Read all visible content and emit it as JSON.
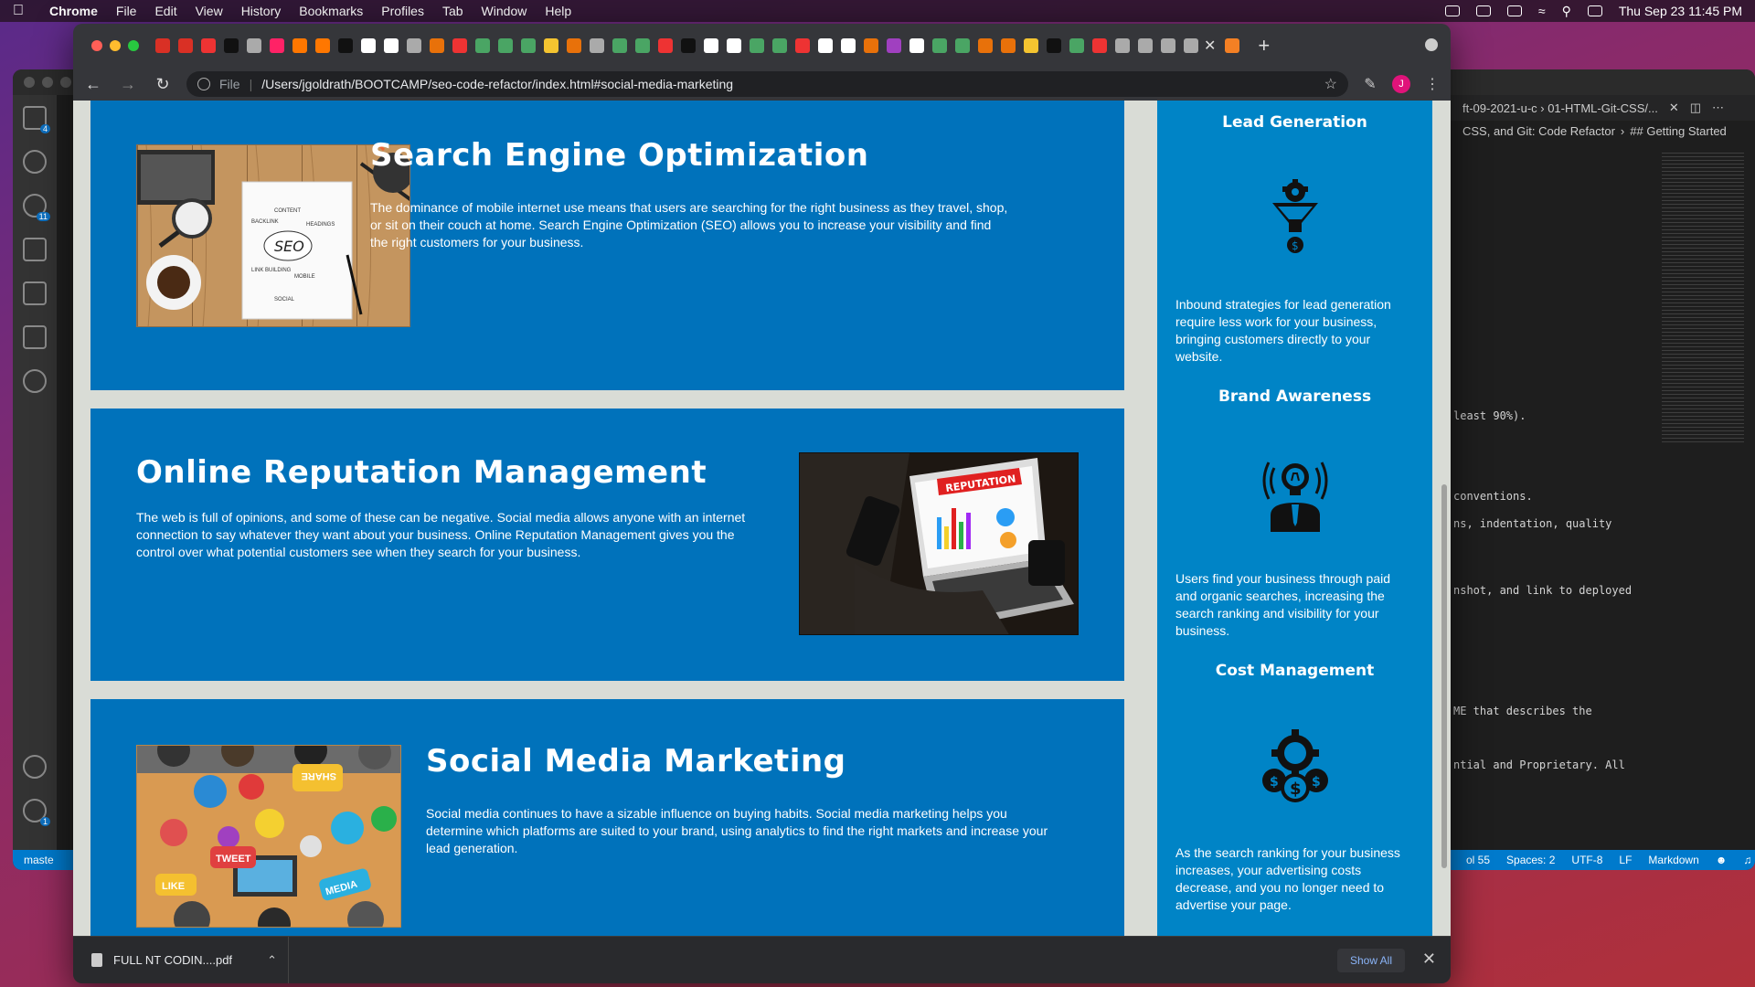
{
  "menubar": {
    "app": "Chrome",
    "items": [
      "File",
      "Edit",
      "View",
      "History",
      "Bookmarks",
      "Profiles",
      "Tab",
      "Window",
      "Help"
    ],
    "datetime": "Thu Sep 23  11:45 PM"
  },
  "browser": {
    "scheme": "File",
    "url": "/Users/jgoldrath/BOOTCAMP/seo-code-refactor/index.html#social-media-marketing",
    "avatar_initial": "J",
    "download": {
      "file": "FULL NT CODIN....pdf",
      "show_all": "Show All"
    }
  },
  "content": [
    {
      "title": "Search Engine Optimization",
      "text": "The dominance of mobile internet use means that users are searching for the right business as they travel, shop, or sit on their couch at home. Search Engine Optimization (SEO) allows you to increase your visibility and find the right customers for your business.",
      "image_icon": "seo-notebook-icon"
    },
    {
      "title": "Online Reputation Management",
      "text": "The web is full of opinions, and some of these can be negative. Social media allows anyone with an internet connection to say whatever they want about your business. Online Reputation Management gives you the control over what potential customers see when they search for your business.",
      "image_label": "REPUTATION",
      "image_icon": "laptop-reputation-icon"
    },
    {
      "title": "Social Media Marketing",
      "text": "Social media continues to have a sizable influence on buying habits. Social media marketing helps you determine which platforms are suited to your brand, using analytics to find the right markets and increase your lead generation.",
      "image_words": [
        "SHARE",
        "TWEET",
        "LIKE",
        "MEDIA"
      ],
      "image_icon": "social-media-icon"
    }
  ],
  "benefits": [
    {
      "title": "Lead Generation",
      "text": "Inbound strategies for lead generation require less work for your business, bringing customers directly to your website.",
      "icon": "funnel-dollar-icon"
    },
    {
      "title": "Brand Awareness",
      "text": "Users find your business through paid and organic searches, increasing the search ranking and visibility for your business.",
      "icon": "lightbulb-person-icon"
    },
    {
      "title": "Cost Management",
      "text": "As the search ranking for your business increases, your advertising costs decrease, and you no longer need to advertise your page.",
      "icon": "gear-dollar-icon"
    }
  ],
  "vscode": {
    "tab": "ft-09-2021-u-c › 01-HTML-Git-CSS/...",
    "breadcrumb": "CSS, and Git: Code Refactor",
    "breadcrumb_section": "## Getting Started",
    "code_lines": [
      "least 90%).",
      "conventions.",
      "ns, indentation, quality",
      "nshot, and link to deployed",
      "ME that describes the",
      "ntial and Proprietary. All"
    ],
    "status": {
      "branch": "maste",
      "col": "ol 55",
      "spaces": "Spaces: 2",
      "encoding": "UTF-8",
      "eol": "LF",
      "lang": "Markdown"
    }
  }
}
